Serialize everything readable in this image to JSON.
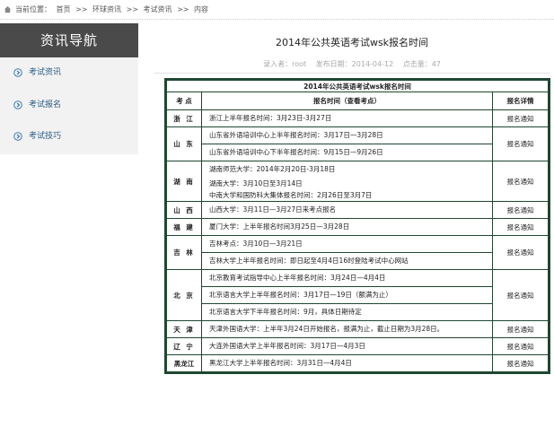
{
  "breadcrumb": {
    "prefix": "当前位置：",
    "items": [
      "首页",
      ">>",
      "环球资讯",
      ">>",
      "考试资讯",
      ">>",
      "内容"
    ]
  },
  "sidebar": {
    "title": "资讯导航",
    "items": [
      {
        "label": "考试资讯"
      },
      {
        "label": "考试报名"
      },
      {
        "label": "考试技巧"
      }
    ]
  },
  "article": {
    "title": "2014年公共英语考试wsk报名时间",
    "meta_author": "录入者：root",
    "meta_date": "发布日期：2014-04-12",
    "meta_hits": "点击量：47"
  },
  "table": {
    "caption": "2014年公共英语考试wsk报名时间",
    "headers": [
      "考 点",
      "报名时间（查看考点）",
      "报名详情"
    ],
    "detail_label": "报名通知",
    "rows": [
      {
        "prov": "浙 江",
        "lines": [
          "浙江上半年报名时间：3月23日-3月27日"
        ]
      },
      {
        "prov": "山 东",
        "lines": [
          "山东省外语培训中心上半年报名时间：3月17日—3月28日",
          "山东省外语培训中心下半年报名时间：9月15日—9月26日"
        ]
      },
      {
        "prov": "湖 南",
        "lines": [
          "湖南师范大学：2014年2月20日-3月18日",
          "湖南大学：3月10日至3月14日",
          "中南大学和国防科大集体报名时间：2月26日至3月7日"
        ]
      },
      {
        "prov": "山 西",
        "lines": [
          "山西大学：3月11日—3月27日来考点报名"
        ]
      },
      {
        "prov": "福 建",
        "lines": [
          "厦门大学：上半年报名时间3月25日—3月28日"
        ]
      },
      {
        "prov": "吉 林",
        "lines": [
          "吉林考点：3月10日—3月21日",
          "吉林大学上半年报名时间：即日起至4月4日16时登陆考试中心网站"
        ]
      },
      {
        "prov": "北 京",
        "lines": [
          "北京教育考试指导中心上半年报名时间：3月24日—4月4日",
          "北京语言大学上半年报名时间：3月17日—19日（额满为止）",
          "北京语言大学下半年报名时间：9月，具体日期待定"
        ]
      },
      {
        "prov": "天 津",
        "lines": [
          "天津外国语大学：上半年3月24日开始报名，报满为止，截止日期为3月28日。"
        ]
      },
      {
        "prov": "辽 宁",
        "lines": [
          "大连外国语大学上半年报名时间：3月17日—4月3日"
        ]
      },
      {
        "prov": "黑龙江",
        "lines": [
          "黑龙江大学上半年报名时间：3月31日—4月4日"
        ]
      }
    ]
  }
}
